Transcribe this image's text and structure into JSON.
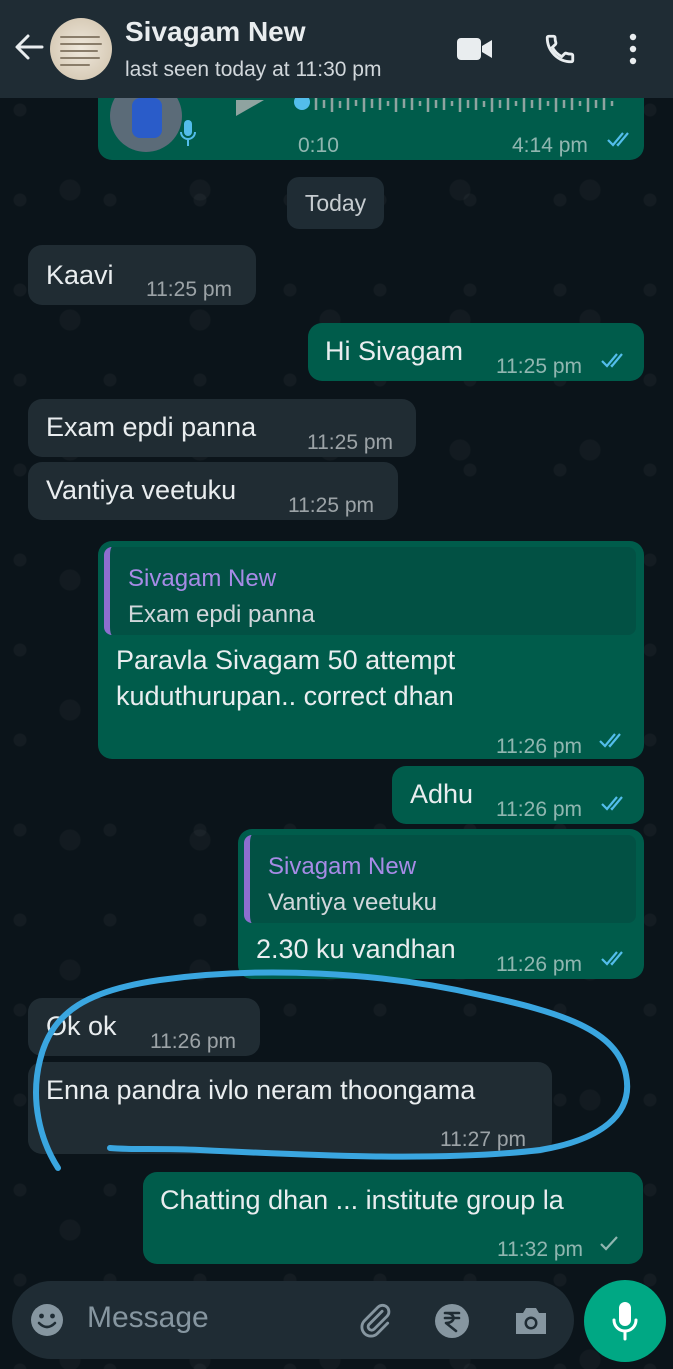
{
  "header": {
    "title": "Sivagam New",
    "status": "last seen today at 11:30 pm"
  },
  "voice_message": {
    "duration": "0:10",
    "time": "4:14 pm"
  },
  "day_divider": "Today",
  "messages": [
    {
      "dir": "in",
      "text": "Kaavi",
      "time": "11:25 pm"
    },
    {
      "dir": "out",
      "text": "Hi Sivagam",
      "time": "11:25 pm",
      "status": "read"
    },
    {
      "dir": "in",
      "text": "Exam epdi panna",
      "time": "11:25 pm"
    },
    {
      "dir": "in",
      "text": "Vantiya veetuku",
      "time": "11:25 pm"
    },
    {
      "dir": "out",
      "quote_name": "Sivagam New",
      "quote_text": "Exam epdi panna",
      "line1": "Paravla Sivagam 50 attempt",
      "line2": "kuduthurupan.. correct dhan",
      "time": "11:26 pm",
      "status": "read"
    },
    {
      "dir": "out",
      "text": "Adhu",
      "time": "11:26 pm",
      "status": "read"
    },
    {
      "dir": "out",
      "quote_name": "Sivagam New",
      "quote_text": "Vantiya veetuku",
      "text": "2.30 ku vandhan",
      "time": "11:26 pm",
      "status": "read"
    },
    {
      "dir": "in",
      "text": "Ok ok",
      "time": "11:26 pm"
    },
    {
      "dir": "in",
      "text": "Enna pandra ivlo neram thoongama",
      "time": "11:27 pm"
    },
    {
      "dir": "out",
      "text": "Chatting dhan ... institute group la",
      "time": "11:32 pm",
      "status": "sent"
    }
  ],
  "composer": {
    "placeholder": "Message"
  },
  "icons": [
    "back-arrow-icon",
    "video-call-icon",
    "phone-icon",
    "more-vert-icon",
    "emoji-icon",
    "attach-icon",
    "rupee-icon",
    "camera-icon",
    "mic-icon",
    "double-tick-icon",
    "single-tick-icon"
  ],
  "colors": {
    "background": "#0b141a",
    "header": "#1f2c34",
    "incoming_bubble": "#202c33",
    "outgoing_bubble": "#005c4b",
    "read_ticks": "#53bdeb",
    "accent": "#00a884",
    "quote_name": "#a78be6",
    "annotation_stroke": "#3aa6e0"
  }
}
